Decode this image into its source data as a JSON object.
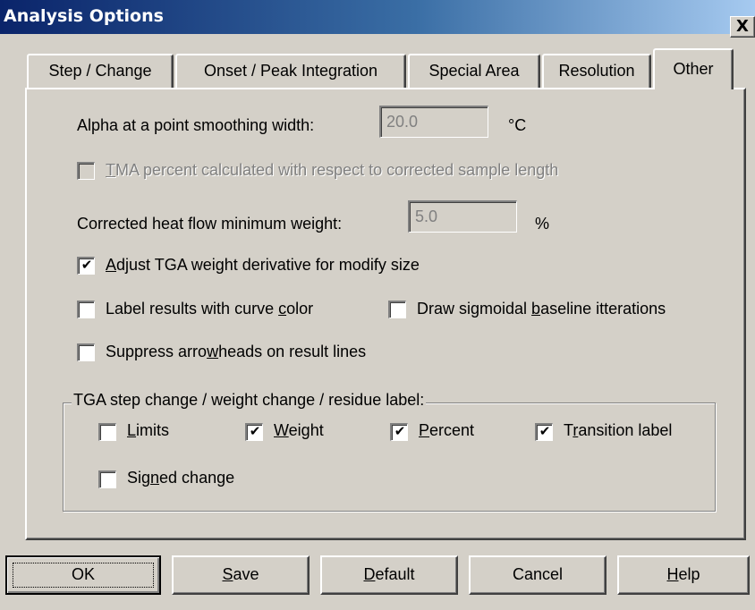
{
  "window": {
    "title": "Analysis Options",
    "close_label": "X"
  },
  "tabs": [
    {
      "label": "Step / Change"
    },
    {
      "label": "Onset / Peak Integration"
    },
    {
      "label": "Special Area"
    },
    {
      "label": "Resolution"
    },
    {
      "label": "Other",
      "active": true
    }
  ],
  "options": {
    "alpha_label": "Alpha at a point smoothing width:",
    "alpha_value": "20.0",
    "alpha_unit": "°C",
    "tma_checked": false,
    "tma_enabled": false,
    "tma_label_key": "T",
    "tma_label_rest": "MA percent calculated with respect to corrected sample length",
    "heatflow_label": "Corrected heat flow minimum weight:",
    "heatflow_value": "5.0",
    "heatflow_unit": "%",
    "adjust_tga_checked": true,
    "adjust_tga_key": "A",
    "adjust_tga_rest": "djust TGA weight derivative for modify size",
    "label_color_checked": false,
    "label_color_pre": "Label results with curve ",
    "label_color_key": "c",
    "label_color_post": "olor",
    "draw_sigmoidal_checked": false,
    "draw_sigmoidal_pre": "Draw sigmoidal ",
    "draw_sigmoidal_key": "b",
    "draw_sigmoidal_post": "aseline itterations",
    "suppress_checked": false,
    "suppress_pre": "Suppress arro",
    "suppress_key": "w",
    "suppress_post": "heads on result lines"
  },
  "tga_group": {
    "title": "TGA step change / weight change / residue label:",
    "limits": {
      "checked": false,
      "key": "L",
      "rest": "imits"
    },
    "weight": {
      "checked": true,
      "key": "W",
      "rest": "eight"
    },
    "percent": {
      "checked": true,
      "key": "P",
      "rest": "ercent"
    },
    "transition": {
      "checked": true,
      "pre": "T",
      "key": "r",
      "post": "ansition label"
    },
    "signed": {
      "checked": false,
      "pre": "Sig",
      "key": "n",
      "post": "ed change"
    }
  },
  "buttons": {
    "ok": "OK",
    "save_key": "S",
    "save_rest": "ave",
    "default_key": "D",
    "default_rest": "efault",
    "cancel": "Cancel",
    "help_key": "H",
    "help_rest": "elp"
  },
  "check_glyph": "✔"
}
